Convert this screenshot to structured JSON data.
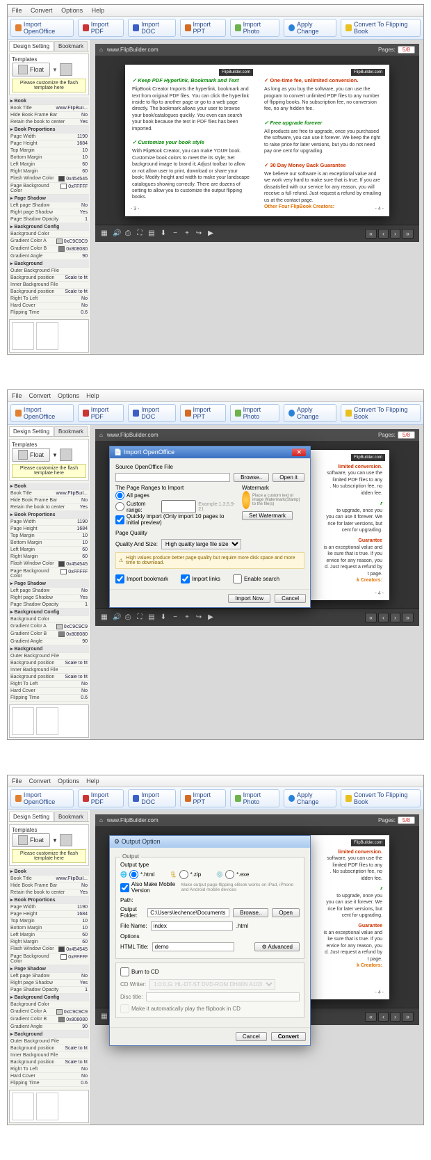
{
  "menu": {
    "file": "File",
    "convert": "Convert",
    "options": "Options",
    "help": "Help"
  },
  "toolbar": {
    "import_oo": "Import OpenOffice",
    "import_pdf": "Import PDF",
    "import_doc": "Import DOC",
    "import_ppt": "Import PPT",
    "import_photo": "Import Photo",
    "apply": "Apply Change",
    "convert": "Convert To Flipping Book"
  },
  "tabs": {
    "design": "Design Setting",
    "bookmark": "Bookmark"
  },
  "tpl": {
    "label": "Templates",
    "float": "Float",
    "note": "Please customize the flash template here"
  },
  "props1": [
    {
      "h": "Book"
    },
    {
      "k": "Book Title",
      "v": "www.FlipBuil..."
    },
    {
      "k": "Hide Book Frame Bar",
      "v": "No"
    },
    {
      "k": "Retain the book to center",
      "v": "Yes"
    },
    {
      "h": "Book Proportions"
    },
    {
      "k": "Page Width",
      "v": "1190"
    },
    {
      "k": "Page Height",
      "v": "1684"
    },
    {
      "k": "Top Margin",
      "v": "10"
    },
    {
      "k": "Bottom Margin",
      "v": "10"
    },
    {
      "k": "Left Margin",
      "v": "60"
    },
    {
      "k": "Right Margin",
      "v": "60"
    },
    {
      "k": "Flash Window Color",
      "v": "0x454545",
      "c": "#454545"
    },
    {
      "k": "Page Background Color",
      "v": "0xFFFFF",
      "c": "#ffffff"
    },
    {
      "h": "Page Shadow"
    },
    {
      "k": "Left page Shadow",
      "v": "No"
    },
    {
      "k": "Right page Shadow",
      "v": "Yes"
    },
    {
      "k": "Page Shadow Opacity",
      "v": "1"
    },
    {
      "h": "Background Config"
    },
    {
      "k": "Background Color",
      "v": ""
    },
    {
      "k": "Gradient Color A",
      "v": "0xC9C9C9",
      "c": "#c9c9c9"
    },
    {
      "k": "Gradient Color B",
      "v": "0x808080",
      "c": "#808080"
    },
    {
      "k": "Gradient Angle",
      "v": "90"
    },
    {
      "h": "Background"
    },
    {
      "k": "Outer Background File",
      "v": ""
    },
    {
      "k": "Background position",
      "v": "Scale to fit"
    },
    {
      "k": "Inner Background File",
      "v": ""
    },
    {
      "k": "Background position",
      "v": "Scale to fit"
    },
    {
      "k": "Right To Left",
      "v": "No"
    },
    {
      "k": "Hard Cover",
      "v": "No"
    },
    {
      "k": "Flipping Time",
      "v": "0.6"
    }
  ],
  "viewer": {
    "url": "www.FlipBuilder.com",
    "pages_lbl": "Pages:",
    "pages": "5/8"
  },
  "leftPage": {
    "hdr": "FlipBuilder.com",
    "t1": "✓ Keep PDF Hyperlink, Bookmark and Text",
    "p1": "FlipBook Creator Imports the hyperlink, bookmark and text from original PDF files. You can click the hyperlink inside to flip to another page or go to a web page directly. The bookmark allows your user to browse your book/catalogues quickly. You even can search your book because the text in PDF files has been imported.",
    "t2": "✓ Customize your book style",
    "p2": "With FlipBook Creator, you can make YOUR book. Customize book colors to meet the its style; Set background image to brand it; Adjust toolbar to allow or not allow user to print, download or share your book; Modify height and width to make your landscape catalogues showing correctly. There are dozens of setting to allow you to customize the output flipping books.",
    "num": "- 3 -"
  },
  "rightPage": {
    "hdr": "FlipBuilder.com",
    "t1": "✓ One-time fee, unlimited conversion.",
    "p1": "As long as you buy the software, you can use the program to convert unlimited PDF files to any number of flipping books. No subscription fee, no conversion fee, no any hidden fee.",
    "t2": "✓ Free upgrade forever",
    "p2": "All products are free to upgrade, once you purchased the software, you can use it forever. We keep the right to raise price for later versions, but you do not need pay one cent for upgrading.",
    "t3": "✓ 30 Day Money Back Guarantee",
    "p3": "We believe our software is an exceptional value and we work very hard to make sure that is true. If you are dissatisfied with our service for any reason, you will receive a full refund. Just request a refund by emailing us at the contact page.",
    "other": "Other Four FlipBook Creators:",
    "num": "- 4 -"
  },
  "dlg1": {
    "title": "Import OpenOffice",
    "src": "Source OpenOffice File",
    "browse": "Browse..",
    "open": "Open it",
    "ranges": "The Page Ranges to Import",
    "all": "All pages",
    "custom": "Custom range:",
    "ex": "Example:1,3,5,9-21",
    "quick": "Quickly import (Only import 10 pages to  initial  preview)",
    "wm": "Watermark",
    "wm_txt": "Place a custom text or image Watermark(Stamp) to the file(s)",
    "wm_btn": "Set Watermark",
    "pq": "Page Quality",
    "qs": "Quality And Size:",
    "qv": "High quality large file size",
    "warn": "High values produce better page quality but require more disk space and more time to download.",
    "ib": "Import bookmark",
    "il": "Import links",
    "es": "Enable search",
    "now": "Import Now",
    "cancel": "Cancel"
  },
  "dlg2": {
    "title": "Output Option",
    "out": "Output",
    "otype": "Output type",
    "html": "*.html",
    "zip": "*.zip",
    "exe": "*.exe",
    "mobile": "Also Make Mobile Version",
    "mobile_t": "Make output page-flipping eBook works on iPad, iPhone and Android mobile devices",
    "path": "Path:",
    "folder": "Output Folder:",
    "fval": "C:\\Users\\lechence\\Documents",
    "browse": "Browse..",
    "open": "Open",
    "fname": "File Name:",
    "fval2": "index",
    "fval3": ".html",
    "opts": "Options",
    "htmlt": "HTML Title:",
    "hval": "demo",
    "adv": "Advanced",
    "burn": "Burn to CD",
    "cddrv": "CD Writer:",
    "cdv": "1:0:0,G: HL-DT-ST DVD-ROM DH40N   A103",
    "disct": "Disc title:",
    "auto": "Make it automatically play the flipbook in CD",
    "cancel": "Cancel",
    "convert": "Convert"
  },
  "peek": {
    "t1": "limited conversion.",
    "p1a": "software, you can use the",
    "p1b": "limited PDF files to any",
    "p1c": ". No subscription fee, no",
    "p1d": "idden fee.",
    "t2": "r",
    "p2a": "to upgrade, once you",
    "p2b": "you can use it forever. We",
    "p2c": "rice for later versions, but",
    "p2d": "cent for upgrading.",
    "t3": "Guarantee",
    "p3a": "is an exceptional value and",
    "p3b": "ke sure that is true. If you",
    "p3c": "ervice for any reason, you",
    "p3d": "d. Just request a refund by",
    "p3e": "t page.",
    "other": "k Creators:"
  }
}
